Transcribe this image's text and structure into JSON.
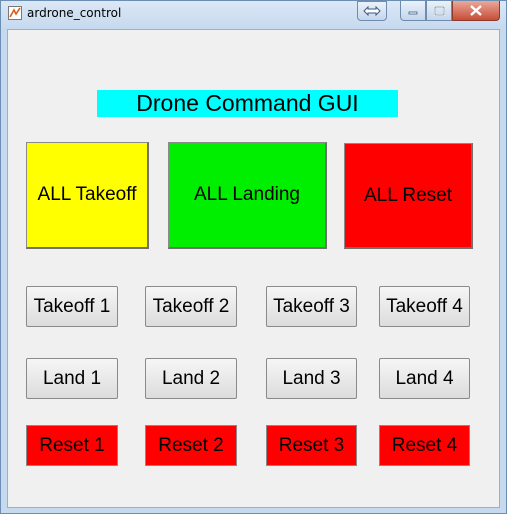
{
  "window": {
    "title": "ardrone_control"
  },
  "titlebar_icons": {
    "app": "matlab-figure-icon",
    "dock": "dock-arrows-icon",
    "minimize": "minimize-icon",
    "maximize": "maximize-icon",
    "close": "close-icon"
  },
  "header": {
    "title": "Drone Command GUI",
    "background": "#00ffff"
  },
  "all_buttons": {
    "takeoff": {
      "label": "ALL Takeoff",
      "color": "#ffff00"
    },
    "landing": {
      "label": "ALL Landing",
      "color": "#00ee00"
    },
    "reset": {
      "label": "ALL Reset",
      "color": "#ff0000"
    }
  },
  "takeoff": [
    "Takeoff 1",
    "Takeoff 2",
    "Takeoff 3",
    "Takeoff 4"
  ],
  "land": [
    "Land 1",
    "Land 2",
    "Land 3",
    "Land 4"
  ],
  "reset": {
    "labels": [
      "Reset 1",
      "Reset 2",
      "Reset 3",
      "Reset 4"
    ],
    "color": "#ff0000"
  }
}
